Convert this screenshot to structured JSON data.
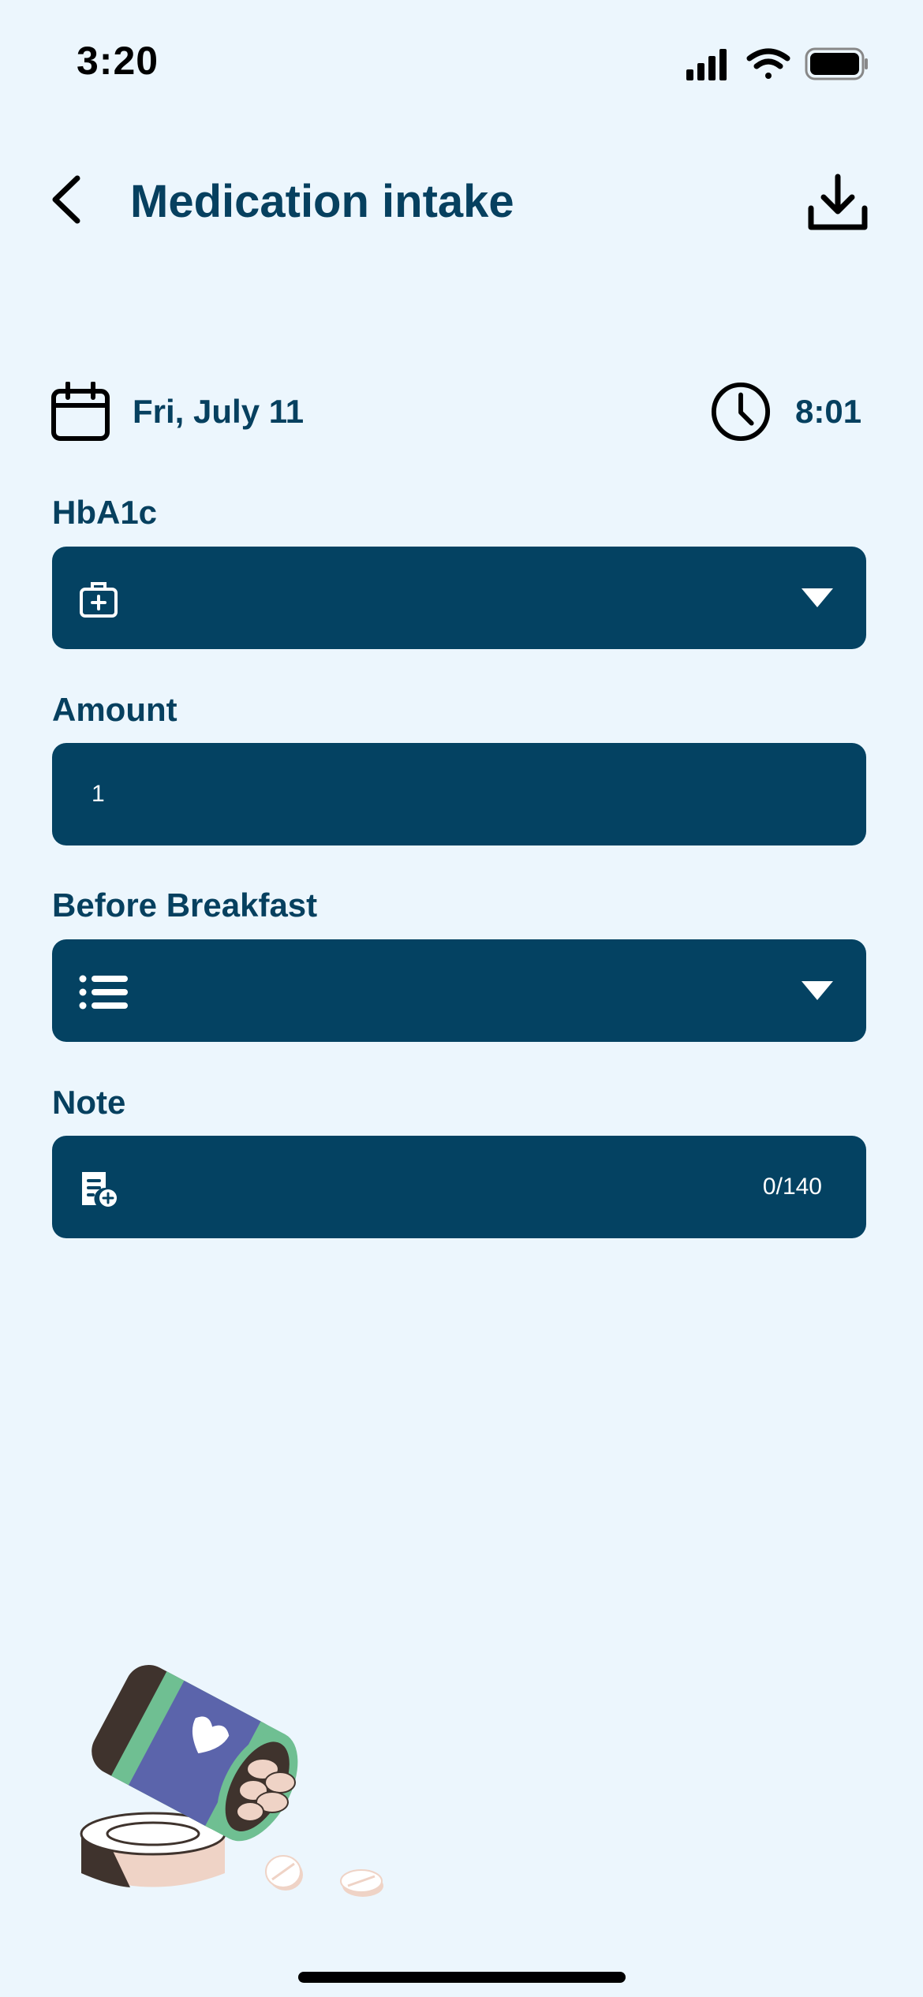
{
  "status_bar": {
    "time": "3:20",
    "icons": [
      "cellular-signal-icon",
      "wifi-icon",
      "battery-icon"
    ]
  },
  "header": {
    "title": "Medication intake",
    "back_icon": "chevron-left-icon",
    "download_icon": "download-icon"
  },
  "entry": {
    "date": "Fri, July 11",
    "time": "8:01",
    "date_icon": "calendar-icon",
    "time_icon": "clock-icon"
  },
  "fields": {
    "medication": {
      "label": "HbA1c",
      "value": "",
      "icon": "medical-kit-icon"
    },
    "amount": {
      "label": "Amount",
      "value": "1"
    },
    "timing": {
      "label": "Before Breakfast",
      "value": "",
      "icon": "list-icon"
    },
    "note": {
      "label": "Note",
      "value": "",
      "counter": "0/140",
      "icon": "note-add-icon"
    }
  },
  "colors": {
    "background": "#ECF6FD",
    "primary": "#06405F",
    "field_bg": "#044262"
  }
}
